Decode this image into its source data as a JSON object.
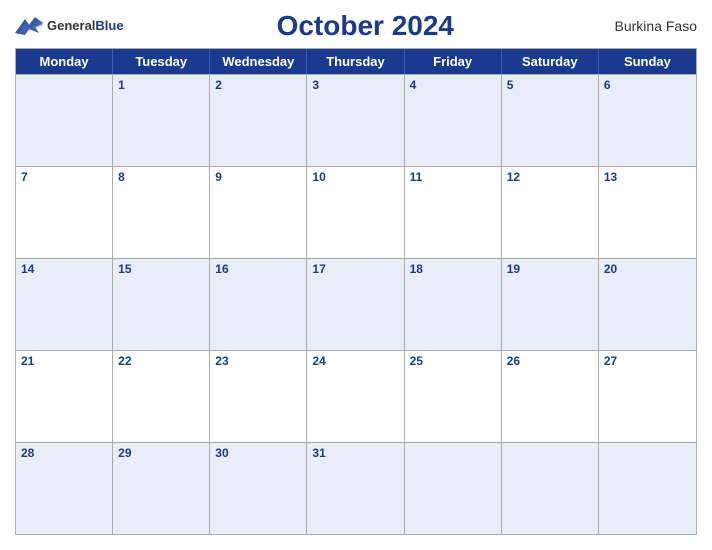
{
  "header": {
    "logo_general": "General",
    "logo_blue": "Blue",
    "title": "October 2024",
    "country": "Burkina Faso"
  },
  "days_of_week": [
    "Monday",
    "Tuesday",
    "Wednesday",
    "Thursday",
    "Friday",
    "Saturday",
    "Sunday"
  ],
  "weeks": [
    [
      "",
      "1",
      "2",
      "3",
      "4",
      "5",
      "6"
    ],
    [
      "7",
      "8",
      "9",
      "10",
      "11",
      "12",
      "13"
    ],
    [
      "14",
      "15",
      "16",
      "17",
      "18",
      "19",
      "20"
    ],
    [
      "21",
      "22",
      "23",
      "24",
      "25",
      "26",
      "27"
    ],
    [
      "28",
      "29",
      "30",
      "31",
      "",
      "",
      ""
    ]
  ]
}
